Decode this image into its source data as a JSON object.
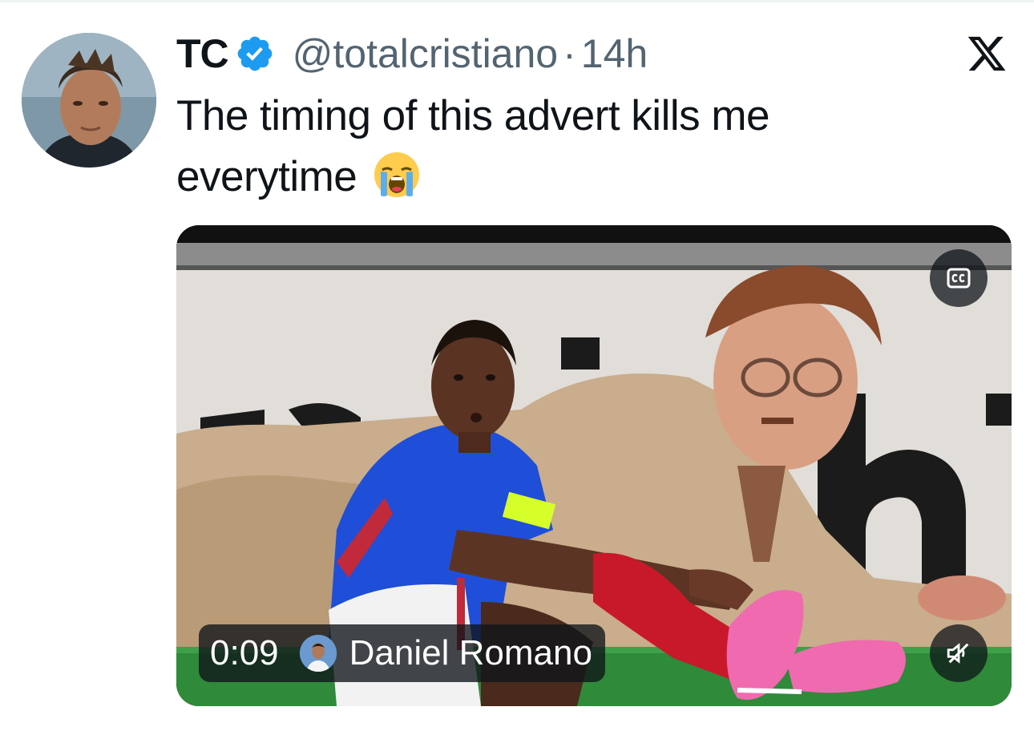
{
  "author": {
    "name": "TC",
    "handle": "@totalcristiano",
    "separator": "·",
    "time": "14h",
    "verified": true
  },
  "tweet": {
    "text": "The timing of this advert kills me everytime",
    "emoji": "loudly-crying-face"
  },
  "video": {
    "duration": "0:09",
    "creator": "Daniel Romano",
    "cc_icon": "closed-captions-icon",
    "mute_icon": "speaker-muted-icon"
  },
  "icons": {
    "platform_logo": "x-logo-icon",
    "verified_badge": "verified-badge-icon"
  },
  "colors": {
    "text_primary": "#0f1419",
    "text_secondary": "#536471",
    "verified_blue": "#1d9bf0",
    "overlay": "#0f1419"
  }
}
